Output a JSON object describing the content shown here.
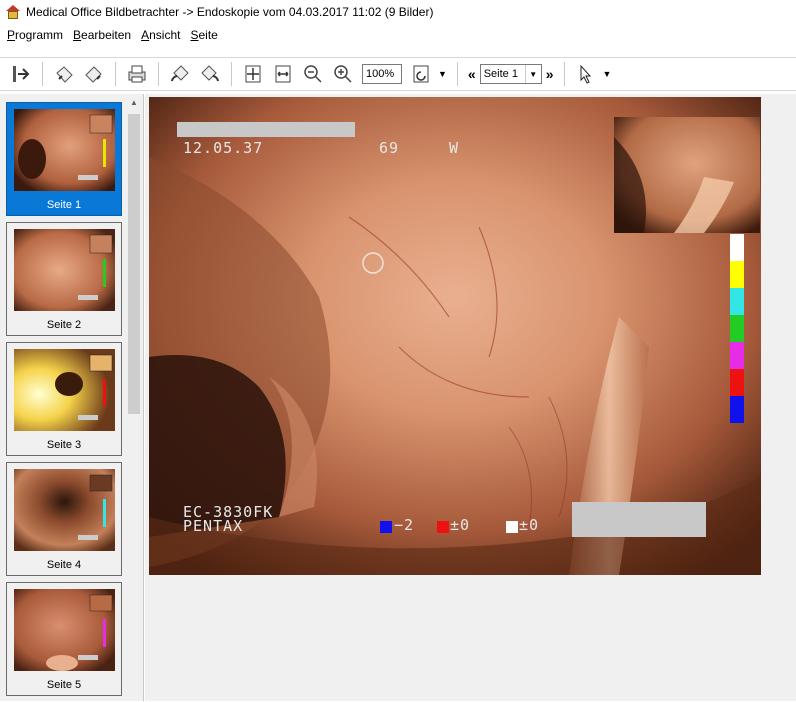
{
  "window": {
    "title": "Medical Office Bildbetrachter -> Endoskopie vom 04.03.2017 11:02 (9 Bilder)"
  },
  "menu": {
    "items": [
      {
        "underline": "P",
        "rest": "rogramm"
      },
      {
        "underline": "B",
        "rest": "earbeiten"
      },
      {
        "underline": "A",
        "rest": "nsicht"
      },
      {
        "underline": "S",
        "rest": "eite"
      }
    ]
  },
  "toolbar": {
    "zoom_value": "100%",
    "page_value": "Seite 1",
    "prev_label": "«",
    "next_label": "»",
    "icons": [
      "exit-icon",
      "rotate-left-icon",
      "rotate-right-icon",
      "print-icon",
      "rotate-ccw-icon",
      "rotate-cw-icon",
      "fit-page-icon",
      "fit-width-icon",
      "zoom-out-icon",
      "zoom-in-icon",
      "rotate-view-icon",
      "pointer-icon"
    ]
  },
  "thumbnails": [
    {
      "label": "Seite 1",
      "selected": true
    },
    {
      "label": "Seite 2",
      "selected": false
    },
    {
      "label": "Seite 3",
      "selected": false
    },
    {
      "label": "Seite 4",
      "selected": false
    },
    {
      "label": "Seite 5",
      "selected": false
    }
  ],
  "image_overlay": {
    "date": "12.05.37",
    "age": "69",
    "sex": "W",
    "scope_model": "EC-3830FK",
    "maker": "PENTAX",
    "blue_value": "−2",
    "red_value": "±0",
    "white_value": "±0"
  },
  "colors": {
    "selection": "#0a78d7",
    "colorbar": [
      "#ffffff",
      "#ffff00",
      "#33e6e6",
      "#22cc22",
      "#e62ce6",
      "#ee1111",
      "#1111ee"
    ]
  }
}
